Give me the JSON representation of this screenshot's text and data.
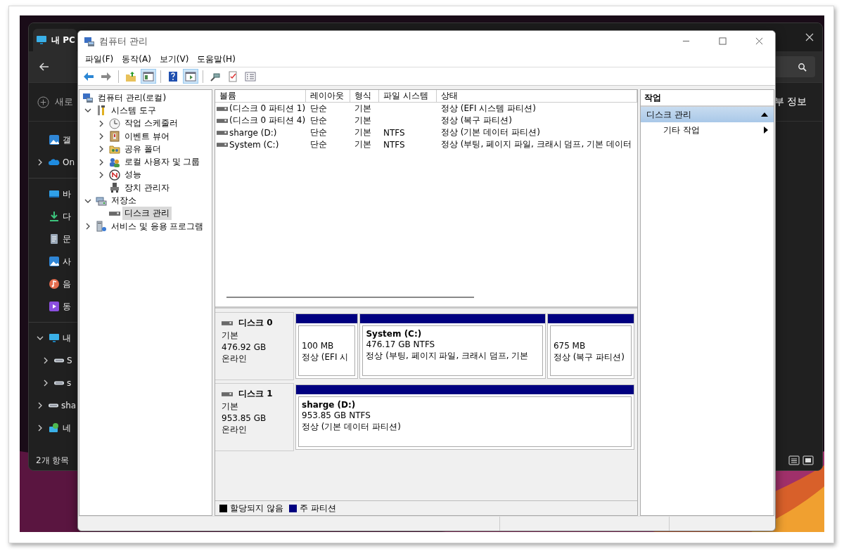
{
  "explorer": {
    "tab_title": "내 PC",
    "new_button": "새로",
    "details_button": "부 정보",
    "status": "2개 항목",
    "nav_groups": [
      {
        "items": [
          {
            "label": "갤",
            "kind": "gallery"
          },
          {
            "label": "On",
            "kind": "cloud",
            "expanded": false
          }
        ]
      },
      {
        "items": [
          {
            "label": "바",
            "kind": "desktop"
          },
          {
            "label": "다",
            "kind": "download"
          },
          {
            "label": "문",
            "kind": "document"
          },
          {
            "label": "사",
            "kind": "gallery"
          },
          {
            "label": "음",
            "kind": "music"
          },
          {
            "label": "동",
            "kind": "video"
          }
        ]
      },
      {
        "items": [
          {
            "label": "내",
            "kind": "pc",
            "expanded": true,
            "children": [
              {
                "label": "S",
                "kind": "drive",
                "expanded": false
              },
              {
                "label": "s",
                "kind": "drive",
                "expanded": false
              }
            ]
          },
          {
            "label": "sha",
            "kind": "drive",
            "expanded": false
          },
          {
            "label": "네",
            "kind": "network",
            "expanded": false
          }
        ]
      }
    ]
  },
  "window": {
    "title": "컴퓨터 관리"
  },
  "menu": [
    "파일(F)",
    "동작(A)",
    "보기(V)",
    "도움말(H)"
  ],
  "toolbar": [
    {
      "kind": "back",
      "pressed": false
    },
    {
      "kind": "forward",
      "pressed": false
    },
    {
      "kind": "separator"
    },
    {
      "kind": "up",
      "pressed": false
    },
    {
      "kind": "tree",
      "pressed": true
    },
    {
      "kind": "separator"
    },
    {
      "kind": "help",
      "pressed": false
    },
    {
      "kind": "actions",
      "pressed": true
    },
    {
      "kind": "separator"
    },
    {
      "kind": "connect",
      "pressed": false
    },
    {
      "kind": "check",
      "pressed": false
    },
    {
      "kind": "properties",
      "pressed": false
    }
  ],
  "tree": [
    {
      "label": "컴퓨터 관리(로컬)",
      "kind": "computer",
      "selected": false,
      "children": [
        {
          "label": "시스템 도구",
          "kind": "tools",
          "expanded": true,
          "selected": false,
          "children": [
            {
              "label": "작업 스케줄러",
              "kind": "clock",
              "expanded": false,
              "selected": false
            },
            {
              "label": "이벤트 뷰어",
              "kind": "event",
              "expanded": false,
              "selected": false
            },
            {
              "label": "공유 폴더",
              "kind": "folder",
              "expanded": false,
              "selected": false
            },
            {
              "label": "로컬 사용자 및 그룹",
              "kind": "users",
              "expanded": false,
              "selected": false
            },
            {
              "label": "성능",
              "kind": "performance",
              "expanded": false,
              "selected": false
            },
            {
              "label": "장치 관리자",
              "kind": "device",
              "selected": false
            }
          ]
        },
        {
          "label": "저장소",
          "kind": "storage",
          "expanded": true,
          "selected": false,
          "children": [
            {
              "label": "디스크 관리",
              "kind": "disk",
              "selected": true
            }
          ]
        },
        {
          "label": "서비스 및 응용 프로그램",
          "kind": "services",
          "expanded": false,
          "selected": false
        }
      ]
    }
  ],
  "volumes": {
    "columns": [
      "볼륨",
      "레이아웃",
      "형식",
      "파일 시스템",
      "상태"
    ],
    "rows": [
      {
        "volume": "(디스크 0 파티션 1)",
        "layout": "단순",
        "type": "기본",
        "status": "정상 (EFI 시스템 파티션)"
      },
      {
        "volume": "(디스크 0 파티션 4)",
        "layout": "단순",
        "type": "기본",
        "status": "정상 (복구 파티션)"
      },
      {
        "volume": "sharge (D:)",
        "layout": "단순",
        "type": "기본",
        "file_system": "NTFS",
        "status": "정상 (기본 데이터 파티션)"
      },
      {
        "volume": "System (C:)",
        "layout": "단순",
        "type": "기본",
        "file_system": "NTFS",
        "status": "정상 (부팅, 페이지 파일, 크래시 덤프, 기본 데이터"
      }
    ]
  },
  "disks": [
    {
      "name": "디스크 0",
      "type": "기본",
      "size": "476.92 GB",
      "status": "온라인",
      "partitions": [
        {
          "kind": "primary",
          "size": "100 MB",
          "status": "정상 (EFI 시"
        },
        {
          "kind": "primary",
          "title": "System  (C:)",
          "size": "476.17 GB NTFS",
          "status": "정상 (부팅, 페이지 파일, 크래시 덤프, 기본"
        },
        {
          "kind": "primary",
          "size": "675 MB",
          "status": "정상 (복구 파티션)"
        }
      ]
    },
    {
      "name": "디스크 1",
      "type": "기본",
      "size": "953.85 GB",
      "status": "온라인",
      "partitions": [
        {
          "kind": "primary",
          "title": "sharge  (D:)",
          "size": "953.85 GB NTFS",
          "status": "정상 (기본 데이터 파티션)"
        }
      ]
    }
  ],
  "legend": [
    {
      "label": "할당되지 않음",
      "color": "#000000"
    },
    {
      "label": "주 파티션",
      "color": "#000080"
    }
  ],
  "actions": {
    "header": "작업",
    "sections": [
      {
        "title": "디스크 관리",
        "expanded": true,
        "items": [
          "기타 작업"
        ]
      }
    ]
  }
}
